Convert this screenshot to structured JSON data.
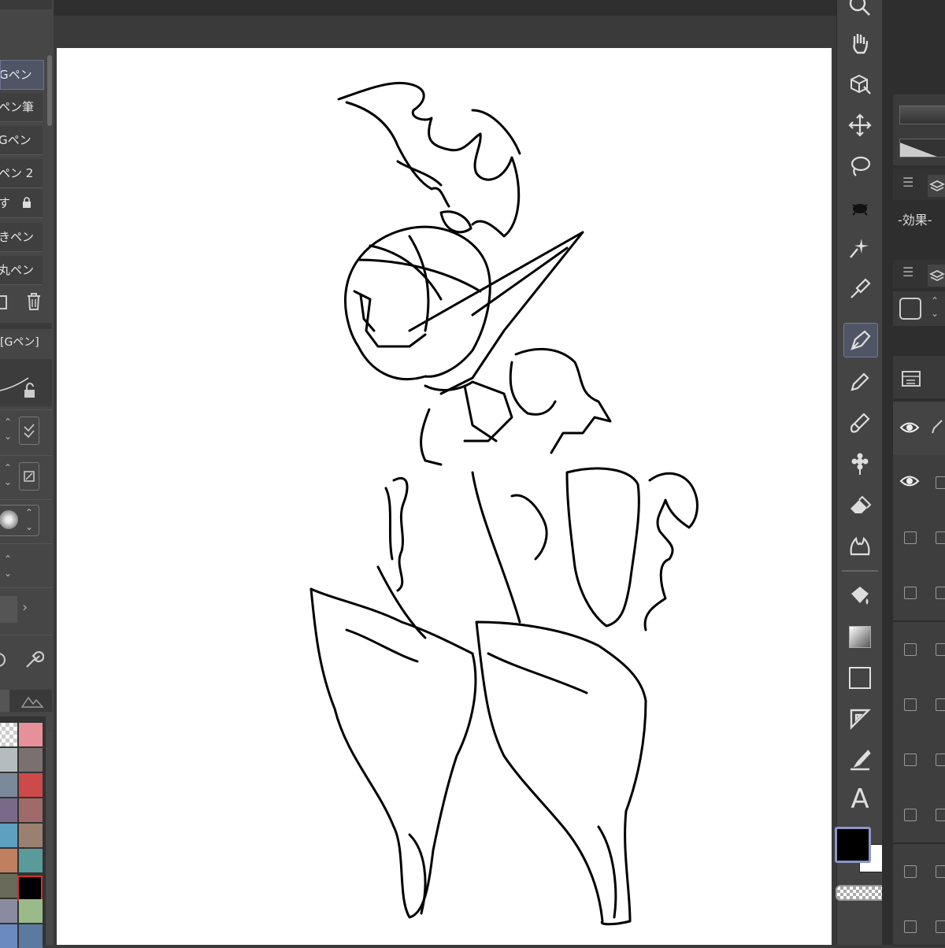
{
  "brushes": [
    {
      "label": "Gペン",
      "selected": true
    },
    {
      "label": "ペン筆",
      "selected": false
    },
    {
      "label": "Gペン",
      "selected": false
    },
    {
      "label": "ペン 2",
      "selected": false
    },
    {
      "label": "す",
      "selected": false
    },
    {
      "label": "きペン",
      "selected": false
    },
    {
      "label": "丸ペン",
      "selected": false
    }
  ],
  "tool_property": {
    "title": "[Gペン]"
  },
  "right_panel": {
    "effect_label": "-効果-"
  },
  "colors": {
    "accent": "#4f5565",
    "main_color": "#000000",
    "sub_color": "#ffffff"
  },
  "palette": [
    "#e8e8e8",
    "#e8909a",
    "#b5bcc0",
    "#7a7070",
    "#7a8a9a",
    "#cc4a4a",
    "#7a6a8a",
    "#a06a6a",
    "#5ea0c0",
    "#9a8070",
    "#c08060",
    "#5a9a9a",
    "#2a2a2a",
    "#000000",
    "#6a8ac0",
    "#9aba8a"
  ],
  "tools": [
    "search-icon",
    "hand-icon",
    "cube-icon",
    "move-icon",
    "lasso-icon",
    "bug-icon",
    "sparkle-icon",
    "eyedropper-icon",
    "pen-icon",
    "pencil-icon",
    "brush-icon",
    "flower-icon",
    "eraser-icon",
    "blend-icon",
    "fill-icon",
    "gradient-icon",
    "rectangle-icon",
    "ruler-icon",
    "correct-line-icon",
    "text-icon"
  ]
}
